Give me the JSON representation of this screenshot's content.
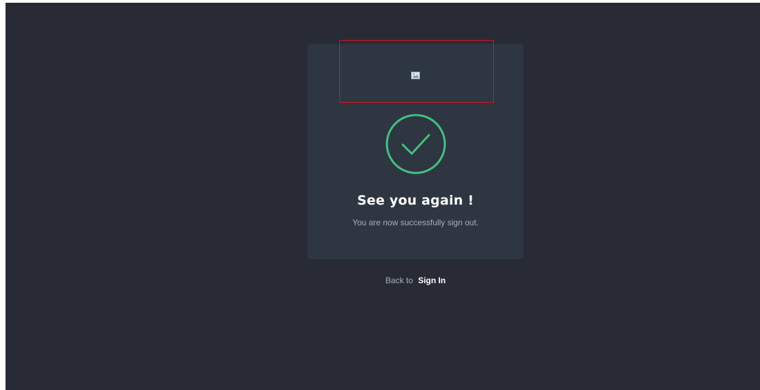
{
  "logout": {
    "title": "See you again !",
    "message": "You are now successfully sign out.",
    "back_prefix": "Back to",
    "sign_in_label": "Sign In",
    "icon": "checkmark-circle-icon",
    "success_color": "#3fc381",
    "highlight_color": "#e0121c"
  }
}
